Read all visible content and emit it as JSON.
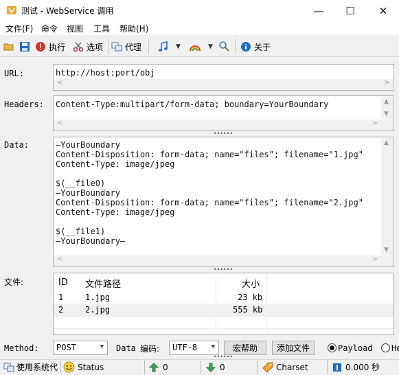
{
  "window": {
    "title": "测试 - WebService 调用",
    "minimize": "—",
    "maximize": "☐",
    "close": "✕"
  },
  "menu": [
    "文件(F)",
    "命令",
    "视图",
    "工具",
    "帮助(H)"
  ],
  "toolbar": {
    "run_label": "执行",
    "options_label": "选项",
    "proxy_label": "代理",
    "about_label": "关于",
    "dropdown_glyph": "▼"
  },
  "form": {
    "url_label": "URL:",
    "url_value": "http://host:port/obj",
    "headers_label": "Headers:",
    "headers_value": "Content-Type:multipart/form-data; boundary=YourBoundary",
    "data_label": "Data:",
    "data_value": "—YourBoundary\nContent-Disposition: form-data; name=\"files\"; filename=\"1.jpg\"\nContent-Type: image/jpeg\n\n$(__file0)\n—YourBoundary\nContent-Disposition: form-data; name=\"files\"; filename=\"2.jpg\"\nContent-Type: image/jpeg\n\n$(__file1)\n—YourBoundary—",
    "files_label": "文件:"
  },
  "files": {
    "columns": [
      "ID",
      "文件路径",
      "大小"
    ],
    "rows": [
      {
        "id": "1",
        "path": "1.jpg",
        "size": "23 kb"
      },
      {
        "id": "2",
        "path": "2.jpg",
        "size": "555 kb"
      }
    ]
  },
  "controls": {
    "method_label": "Method:",
    "method_value": "POST",
    "data_label": "Data",
    "encoding_label": "编码:",
    "encoding_value": "UTF-8",
    "macro_help_button": "宏帮助",
    "add_file_button": "添加文件",
    "payload_label": "Payload",
    "other_radio_label": "He"
  },
  "status": {
    "proxy_text": "使用系统代",
    "status_text": "Status",
    "upload_value": "0",
    "download_value": "0",
    "charset_text": "Charset",
    "time_value": "0.000 秒"
  },
  "colors": {
    "accent_red": "#d93025",
    "save_blue": "#1e6fbf",
    "selected_row": "#f0f0f0"
  },
  "scroll": {
    "left_arrow": "<",
    "right_arrow": ">",
    "up_arrow": "▲",
    "down_arrow": "▼"
  },
  "splitter_glyph": "••••••"
}
